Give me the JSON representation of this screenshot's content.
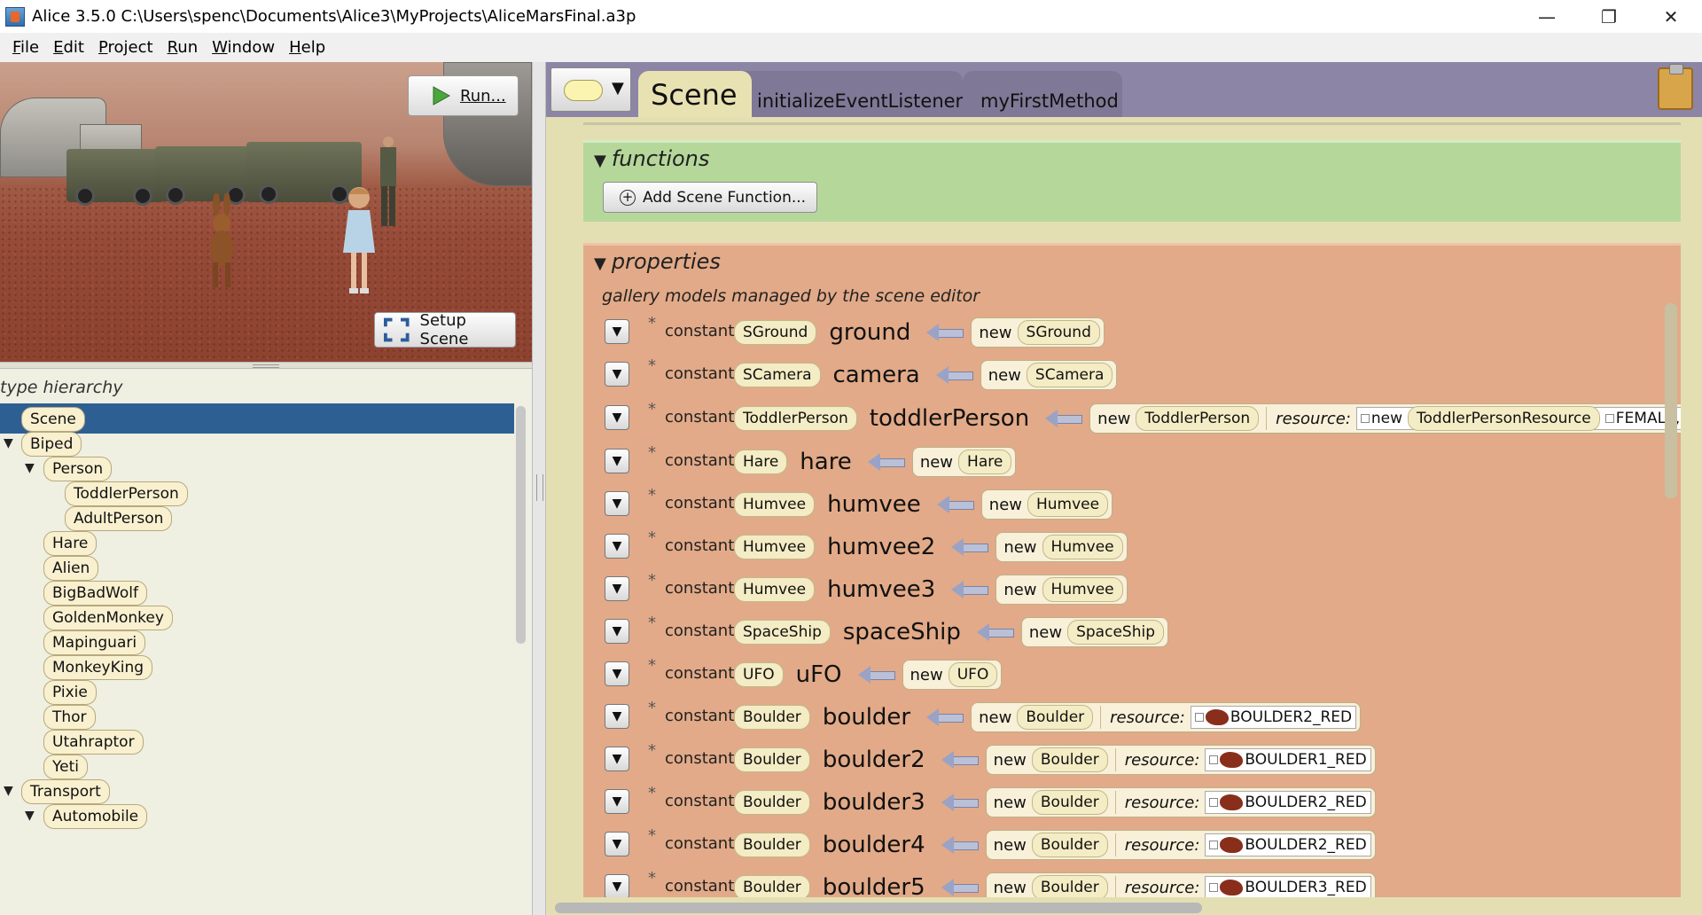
{
  "window": {
    "title": "Alice 3.5.0 C:\\Users\\spenc\\Documents\\Alice3\\MyProjects\\AliceMarsFinal.a3p",
    "minimize": "—",
    "restore": "❐",
    "close": "✕"
  },
  "menu": [
    {
      "pre": "",
      "u": "F",
      "post": "ile"
    },
    {
      "pre": "",
      "u": "E",
      "post": "dit"
    },
    {
      "pre": "",
      "u": "P",
      "post": "roject"
    },
    {
      "pre": "",
      "u": "R",
      "post": "un"
    },
    {
      "pre": "",
      "u": "W",
      "post": "indow"
    },
    {
      "pre": "",
      "u": "H",
      "post": "elp"
    }
  ],
  "scene_view": {
    "run_label": "Run...",
    "setup_label": "Setup Scene"
  },
  "type_hierarchy": {
    "label": "type hierarchy",
    "items": [
      "Scene",
      "Biped",
      "Person",
      "ToddlerPerson",
      "AdultPerson",
      "Hare",
      "Alien",
      "BigBadWolf",
      "GoldenMonkey",
      "Mapinguari",
      "MonkeyKing",
      "Pixie",
      "Thor",
      "Utahraptor",
      "Yeti",
      "Transport",
      "Automobile"
    ],
    "selected": "Scene"
  },
  "editor": {
    "tabs": [
      "Scene",
      "initializeEventListeners",
      "myFirstMethod"
    ],
    "functions": {
      "title": "functions",
      "add_button": "Add Scene Function..."
    },
    "properties": {
      "title": "properties",
      "note": "gallery models managed by the scene editor",
      "keyword": "constant",
      "new_kw": "new",
      "resource_kw": "resource:",
      "rows": [
        {
          "type": "SGround",
          "name": "ground",
          "ctor": "SGround"
        },
        {
          "type": "SCamera",
          "name": "camera",
          "ctor": "SCamera"
        },
        {
          "type": "ToddlerPerson",
          "name": "toddlerPerson",
          "ctor": "ToddlerPerson",
          "resource_new": "new",
          "resource_type": "ToddlerPersonResource",
          "resource_val": "FEMALE,"
        },
        {
          "type": "Hare",
          "name": "hare",
          "ctor": "Hare"
        },
        {
          "type": "Humvee",
          "name": "humvee",
          "ctor": "Humvee"
        },
        {
          "type": "Humvee",
          "name": "humvee2",
          "ctor": "Humvee"
        },
        {
          "type": "Humvee",
          "name": "humvee3",
          "ctor": "Humvee"
        },
        {
          "type": "SpaceShip",
          "name": "spaceShip",
          "ctor": "SpaceShip"
        },
        {
          "type": "UFO",
          "name": "uFO",
          "ctor": "UFO"
        },
        {
          "type": "Boulder",
          "name": "boulder",
          "ctor": "Boulder",
          "rock": "BOULDER2_RED"
        },
        {
          "type": "Boulder",
          "name": "boulder2",
          "ctor": "Boulder",
          "rock": "BOULDER1_RED"
        },
        {
          "type": "Boulder",
          "name": "boulder3",
          "ctor": "Boulder",
          "rock": "BOULDER2_RED"
        },
        {
          "type": "Boulder",
          "name": "boulder4",
          "ctor": "Boulder",
          "rock": "BOULDER2_RED"
        },
        {
          "type": "Boulder",
          "name": "boulder5",
          "ctor": "Boulder",
          "rock": "BOULDER3_RED"
        }
      ]
    }
  },
  "colors": {
    "functions_bg": "#b5d89a",
    "properties_bg": "#e2aa88",
    "tabbar": "#8d85a5",
    "selection": "#2e5f93"
  }
}
